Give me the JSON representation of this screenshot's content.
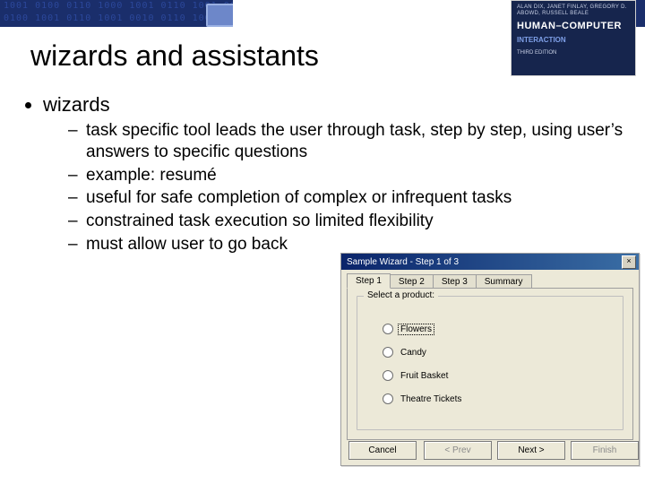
{
  "banner": {
    "book": {
      "authors": "ALAN DIX, JANET FINLAY,\nGREGORY D. ABOWD, RUSSELL BEALE",
      "title_line1": "HUMAN–COMPUTER",
      "title_line2": "INTERACTION",
      "edition": "THIRD EDITION"
    }
  },
  "slide": {
    "title": "wizards and assistants",
    "bullet1": "wizards",
    "sub": [
      "task specific tool leads the user through task, step by step, using user’s answers to specific questions",
      "example: resumé",
      "useful for safe completion of complex or infrequent tasks",
      "constrained task execution so limited flexibility",
      "must allow user to go back"
    ]
  },
  "wizard": {
    "title": "Sample Wizard - Step 1 of 3",
    "close": "×",
    "tabs": [
      "Step 1",
      "Step 2",
      "Step 3",
      "Summary"
    ],
    "active_tab": 0,
    "group_legend": "Select a product:",
    "options": [
      "Flowers",
      "Candy",
      "Fruit Basket",
      "Theatre Tickets"
    ],
    "focused_option": 0,
    "buttons": {
      "cancel": "Cancel",
      "prev": "< Prev",
      "next": "Next >",
      "finish": "Finish"
    }
  }
}
